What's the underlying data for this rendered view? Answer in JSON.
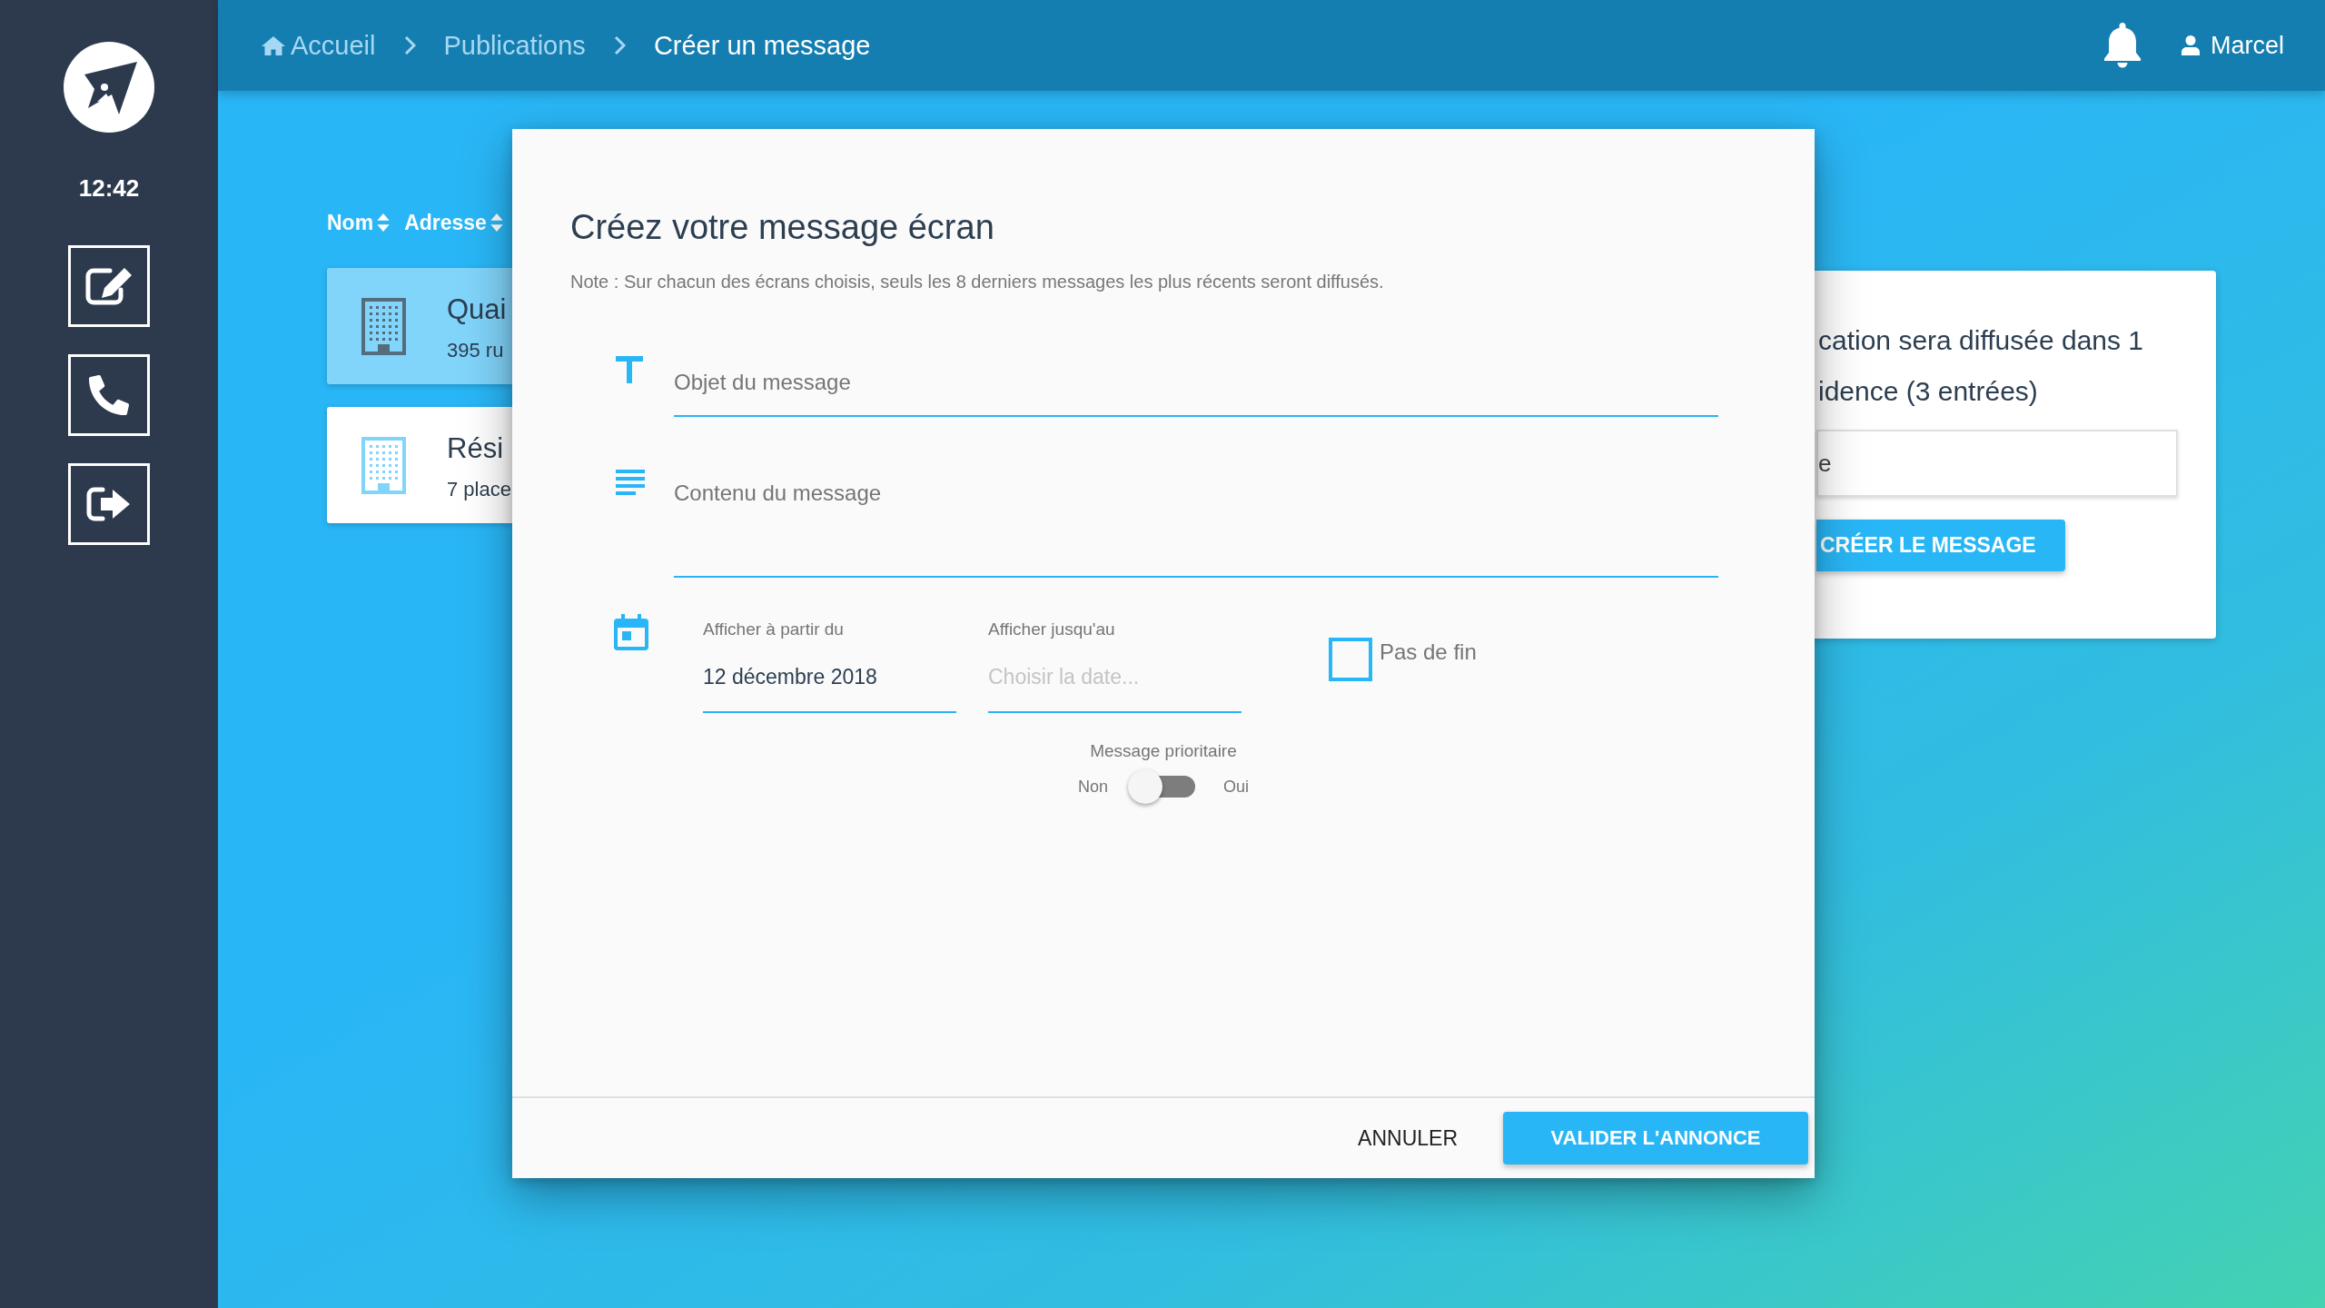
{
  "sidebar": {
    "time": "12:42"
  },
  "breadcrumbs": [
    {
      "label": "Accueil",
      "current": false
    },
    {
      "label": "Publications",
      "current": false
    },
    {
      "label": "Créer un message",
      "current": true
    }
  ],
  "user": {
    "name": "Marcel"
  },
  "residence_list": {
    "sort_headers": [
      "Nom",
      "Adresse"
    ],
    "items": [
      {
        "title": "Quai",
        "subtitle": "395 ru",
        "selected": true
      },
      {
        "title": "Rési",
        "subtitle": "7 place",
        "selected": false
      }
    ]
  },
  "summary": {
    "lines": [
      "cation sera diffusée dans 1",
      "idence (3 entrées)"
    ],
    "field": {
      "value": "e"
    },
    "button": "CRÉER LE MESSAGE"
  },
  "modal": {
    "title": "Créez votre message écran",
    "note": "Note : Sur chacun des écrans choisis, seuls les 8 derniers messages les plus récents seront diffusés.",
    "subject": {
      "placeholder": "Objet du message"
    },
    "content": {
      "placeholder": "Contenu du message"
    },
    "start_date": {
      "label": "Afficher à partir du",
      "value": "12 décembre 2018"
    },
    "end_date": {
      "label": "Afficher jusqu'au",
      "placeholder": "Choisir la date..."
    },
    "no_end": {
      "label": "Pas de fin",
      "checked": false
    },
    "priority": {
      "label": "Message prioritaire",
      "off_label": "Non",
      "on_label": "Oui",
      "on": false
    },
    "buttons": [
      {
        "label": "ANNULER",
        "kind": "text"
      },
      {
        "label": "VALIDER L'ANNONCE",
        "kind": "primary"
      }
    ]
  }
}
